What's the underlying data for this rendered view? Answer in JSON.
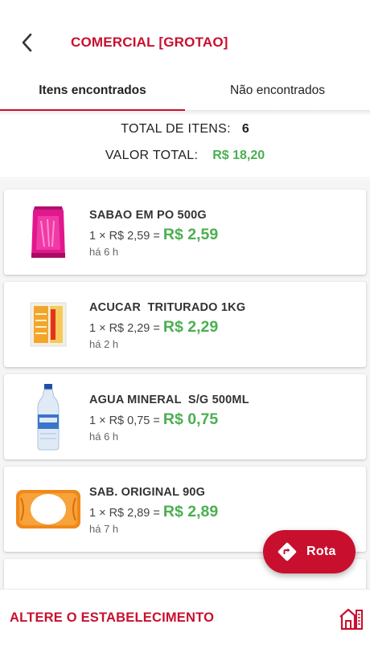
{
  "header": {
    "title": "COMERCIAL [GROTAO]",
    "back_icon": "chevron-left-icon"
  },
  "tabs": [
    {
      "label": "Itens encontrados",
      "active": true
    },
    {
      "label": "Não encontrados",
      "active": false
    }
  ],
  "summary": {
    "total_items_label": "TOTAL DE ITENS:",
    "total_items_value": "6",
    "total_value_label": "VALOR TOTAL:",
    "total_value": "R$ 18,20"
  },
  "items": [
    {
      "name": "SABAO EM PO 500G",
      "quantity_price": "1 × R$ 2,59 =",
      "total": "R$ 2,59",
      "time": "há 6 h",
      "thumbnail": "detergent-pouch"
    },
    {
      "name": "ACUCAR  TRITURADO 1KG",
      "quantity_price": "1 × R$ 2,29 =",
      "total": "R$ 2,29",
      "time": "há 2 h",
      "thumbnail": "sugar-bag"
    },
    {
      "name": "AGUA MINERAL  S/G 500ML",
      "quantity_price": "1 × R$ 0,75 =",
      "total": "R$ 0,75",
      "time": "há 6 h",
      "thumbnail": "water-bottle"
    },
    {
      "name": "SAB. ORIGINAL 90G",
      "quantity_price": "1 × R$ 2,89 =",
      "total": "R$ 2,89",
      "time": "há 7 h",
      "thumbnail": "soap-bar"
    }
  ],
  "fab": {
    "label": "Rota",
    "icon": "directions-icon"
  },
  "bottom": {
    "change_store_label": "ALTERE O ESTABELECIMENTO",
    "store_icon": "store-icon"
  },
  "colors": {
    "accent": "#c8102e",
    "price_green": "#4caf50"
  }
}
